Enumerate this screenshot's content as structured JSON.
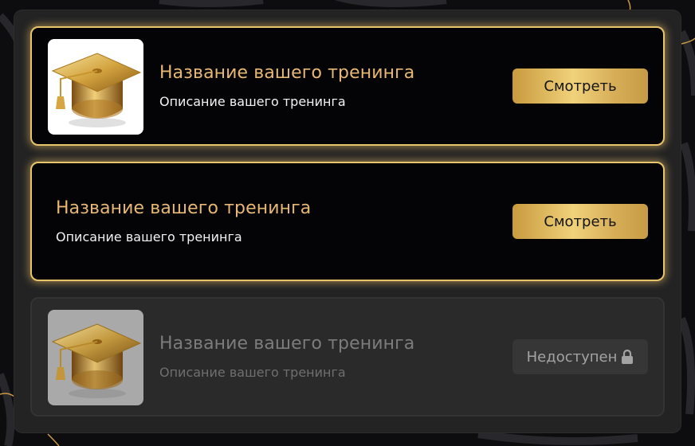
{
  "colors": {
    "accent_gold": "#e8c46a",
    "title_gold": "#e6b874",
    "card_active_bg": "#040406",
    "card_locked_bg": "#2a2a2b",
    "panel_bg": "#232324"
  },
  "trainings": [
    {
      "title": "Название вашего тренинга",
      "description": "Описание вашего тренинга",
      "button_label": "Смотреть",
      "state": "available",
      "thumbnail_icon": "graduation-cap-icon"
    },
    {
      "title": "Название вашего тренинга",
      "description": "Описание вашего тренинга",
      "button_label": "Смотреть",
      "state": "available",
      "thumbnail_icon": null
    },
    {
      "title": "Название вашего тренинга",
      "description": "Описание вашего тренинга",
      "button_label": "Недоступен",
      "state": "locked",
      "thumbnail_icon": "graduation-cap-icon",
      "lock_icon": "lock-icon"
    }
  ]
}
